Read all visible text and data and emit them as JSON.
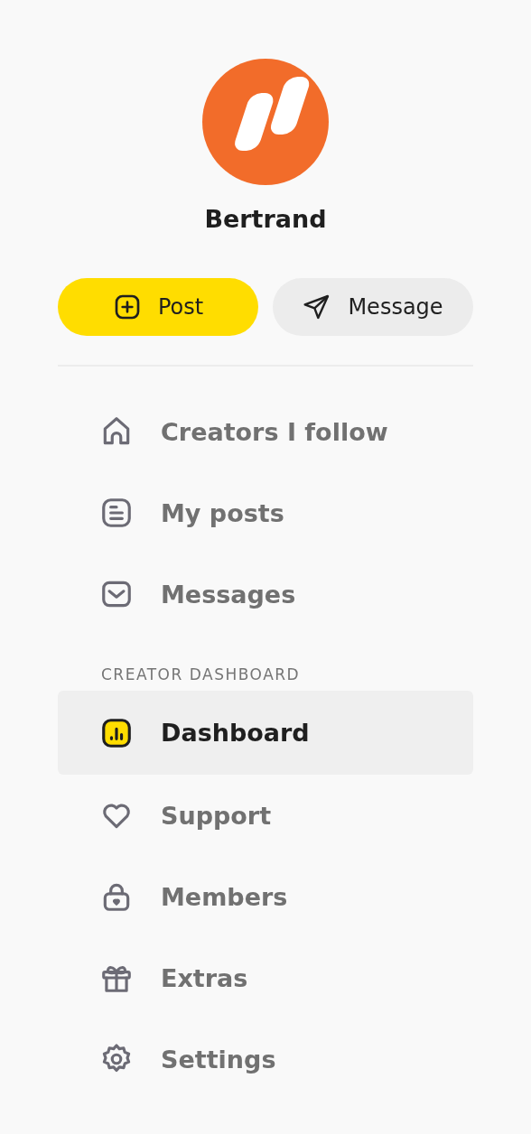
{
  "profile": {
    "name": "Bertrand"
  },
  "actions": [
    {
      "kind": "post",
      "label": "Post"
    },
    {
      "kind": "message",
      "label": "Message"
    }
  ],
  "nav": [
    {
      "kind": "home",
      "label": "Creators I follow",
      "selected": false
    },
    {
      "kind": "posts",
      "label": "My posts",
      "selected": false
    },
    {
      "kind": "messages",
      "label": "Messages",
      "selected": false
    }
  ],
  "creator_dashboard": {
    "heading": "CREATOR DASHBOARD",
    "items": [
      {
        "kind": "dashboard",
        "label": "Dashboard",
        "selected": true
      },
      {
        "kind": "support",
        "label": "Support",
        "selected": false
      },
      {
        "kind": "members",
        "label": "Members",
        "selected": false
      },
      {
        "kind": "extras",
        "label": "Extras",
        "selected": false
      },
      {
        "kind": "settings",
        "label": "Settings",
        "selected": false
      }
    ]
  }
}
